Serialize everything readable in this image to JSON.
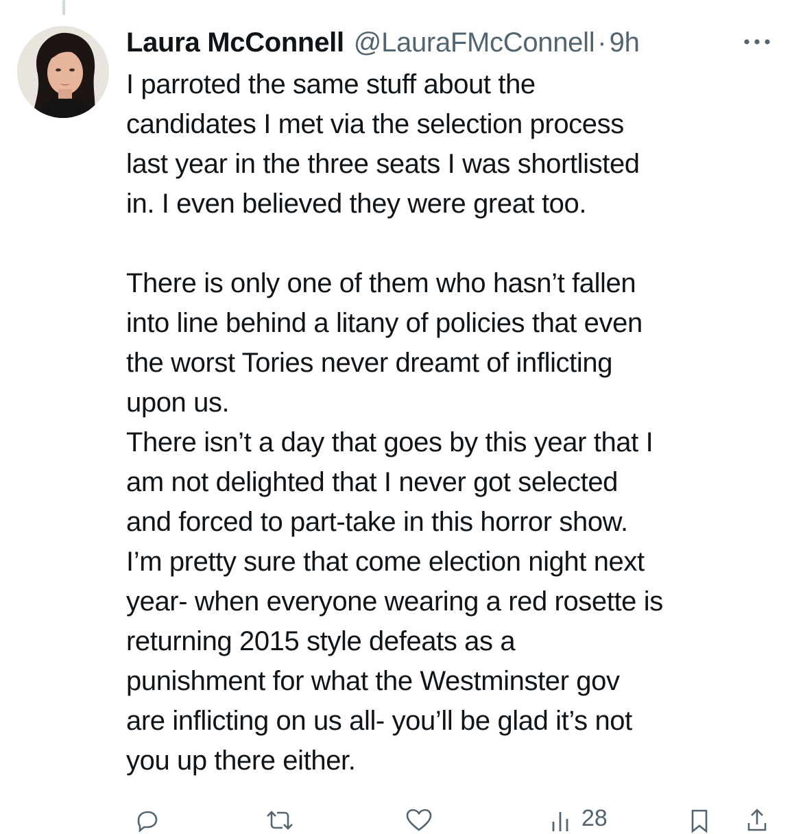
{
  "tweet": {
    "display_name": "Laura McConnell",
    "handle": "@LauraFMcConnell",
    "separator": "·",
    "time": "9h",
    "text": "I parroted the same stuff about the\ncandidates I met via the selection process\nlast year in the three seats I was shortlisted\nin. I even believed they were great too.\n\nThere is only one of them who hasn’t fallen\ninto line behind a litany of policies that even\nthe worst Tories never dreamt of inflicting\nupon us.\nThere isn’t a day that goes by this year that I\nam not delighted that I never got selected\nand forced to part-take in this horror show.\nI’m pretty sure that come election night next\nyear- when everyone wearing a red rosette is\nreturning 2015 style defeats as a\npunishment for what the Westminster gov\nare inflicting on us all- you’ll be glad it’s not\nyou up there either."
  },
  "actions": {
    "views_count": "28"
  },
  "icons": {
    "more": "more-horizontal-icon",
    "reply": "reply-icon",
    "retweet": "retweet-icon",
    "like": "like-icon",
    "views": "views-icon",
    "bookmark": "bookmark-icon",
    "share": "share-icon"
  },
  "colors": {
    "text_primary": "#0f1419",
    "text_secondary": "#536471",
    "thread_line": "#cfd9de"
  }
}
